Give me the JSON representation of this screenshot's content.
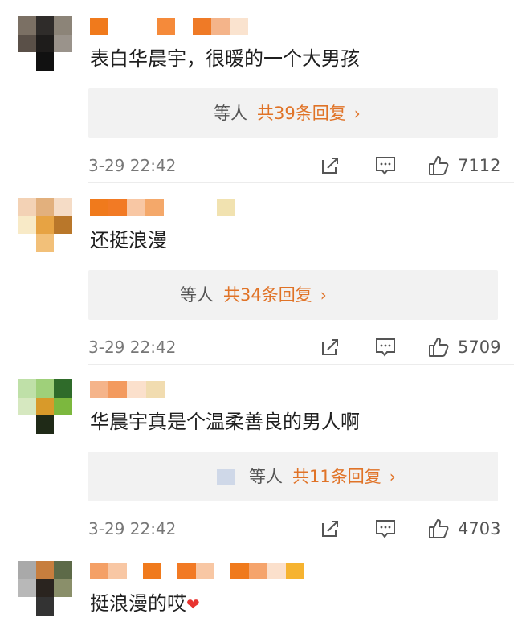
{
  "comments": [
    {
      "text": "表白华晨宇，很暖的一个大男孩",
      "reply_users": "等人",
      "reply_count": "共39条回复",
      "reply_arrow": "›",
      "time": "3-29 22:42",
      "likes": "7112"
    },
    {
      "text": "还挺浪漫",
      "reply_users": "等人",
      "reply_count": "共34条回复",
      "reply_arrow": "›",
      "time": "3-29 22:42",
      "likes": "5709"
    },
    {
      "text": "华晨宇真是个温柔善良的男人啊",
      "reply_users": "等人",
      "reply_count": "共11条回复",
      "reply_arrow": "›",
      "time": "3-29 22:42",
      "likes": "4703"
    },
    {
      "text": "挺浪漫的哎",
      "text_emoji": "❤"
    }
  ],
  "icons": {
    "share": "share-icon",
    "comment": "comment-icon",
    "like": "thumbs-up-icon"
  },
  "colors": {
    "reply_accent": "#e07327",
    "reply_bg": "#f2f2f2",
    "heart": "#e8332f"
  }
}
